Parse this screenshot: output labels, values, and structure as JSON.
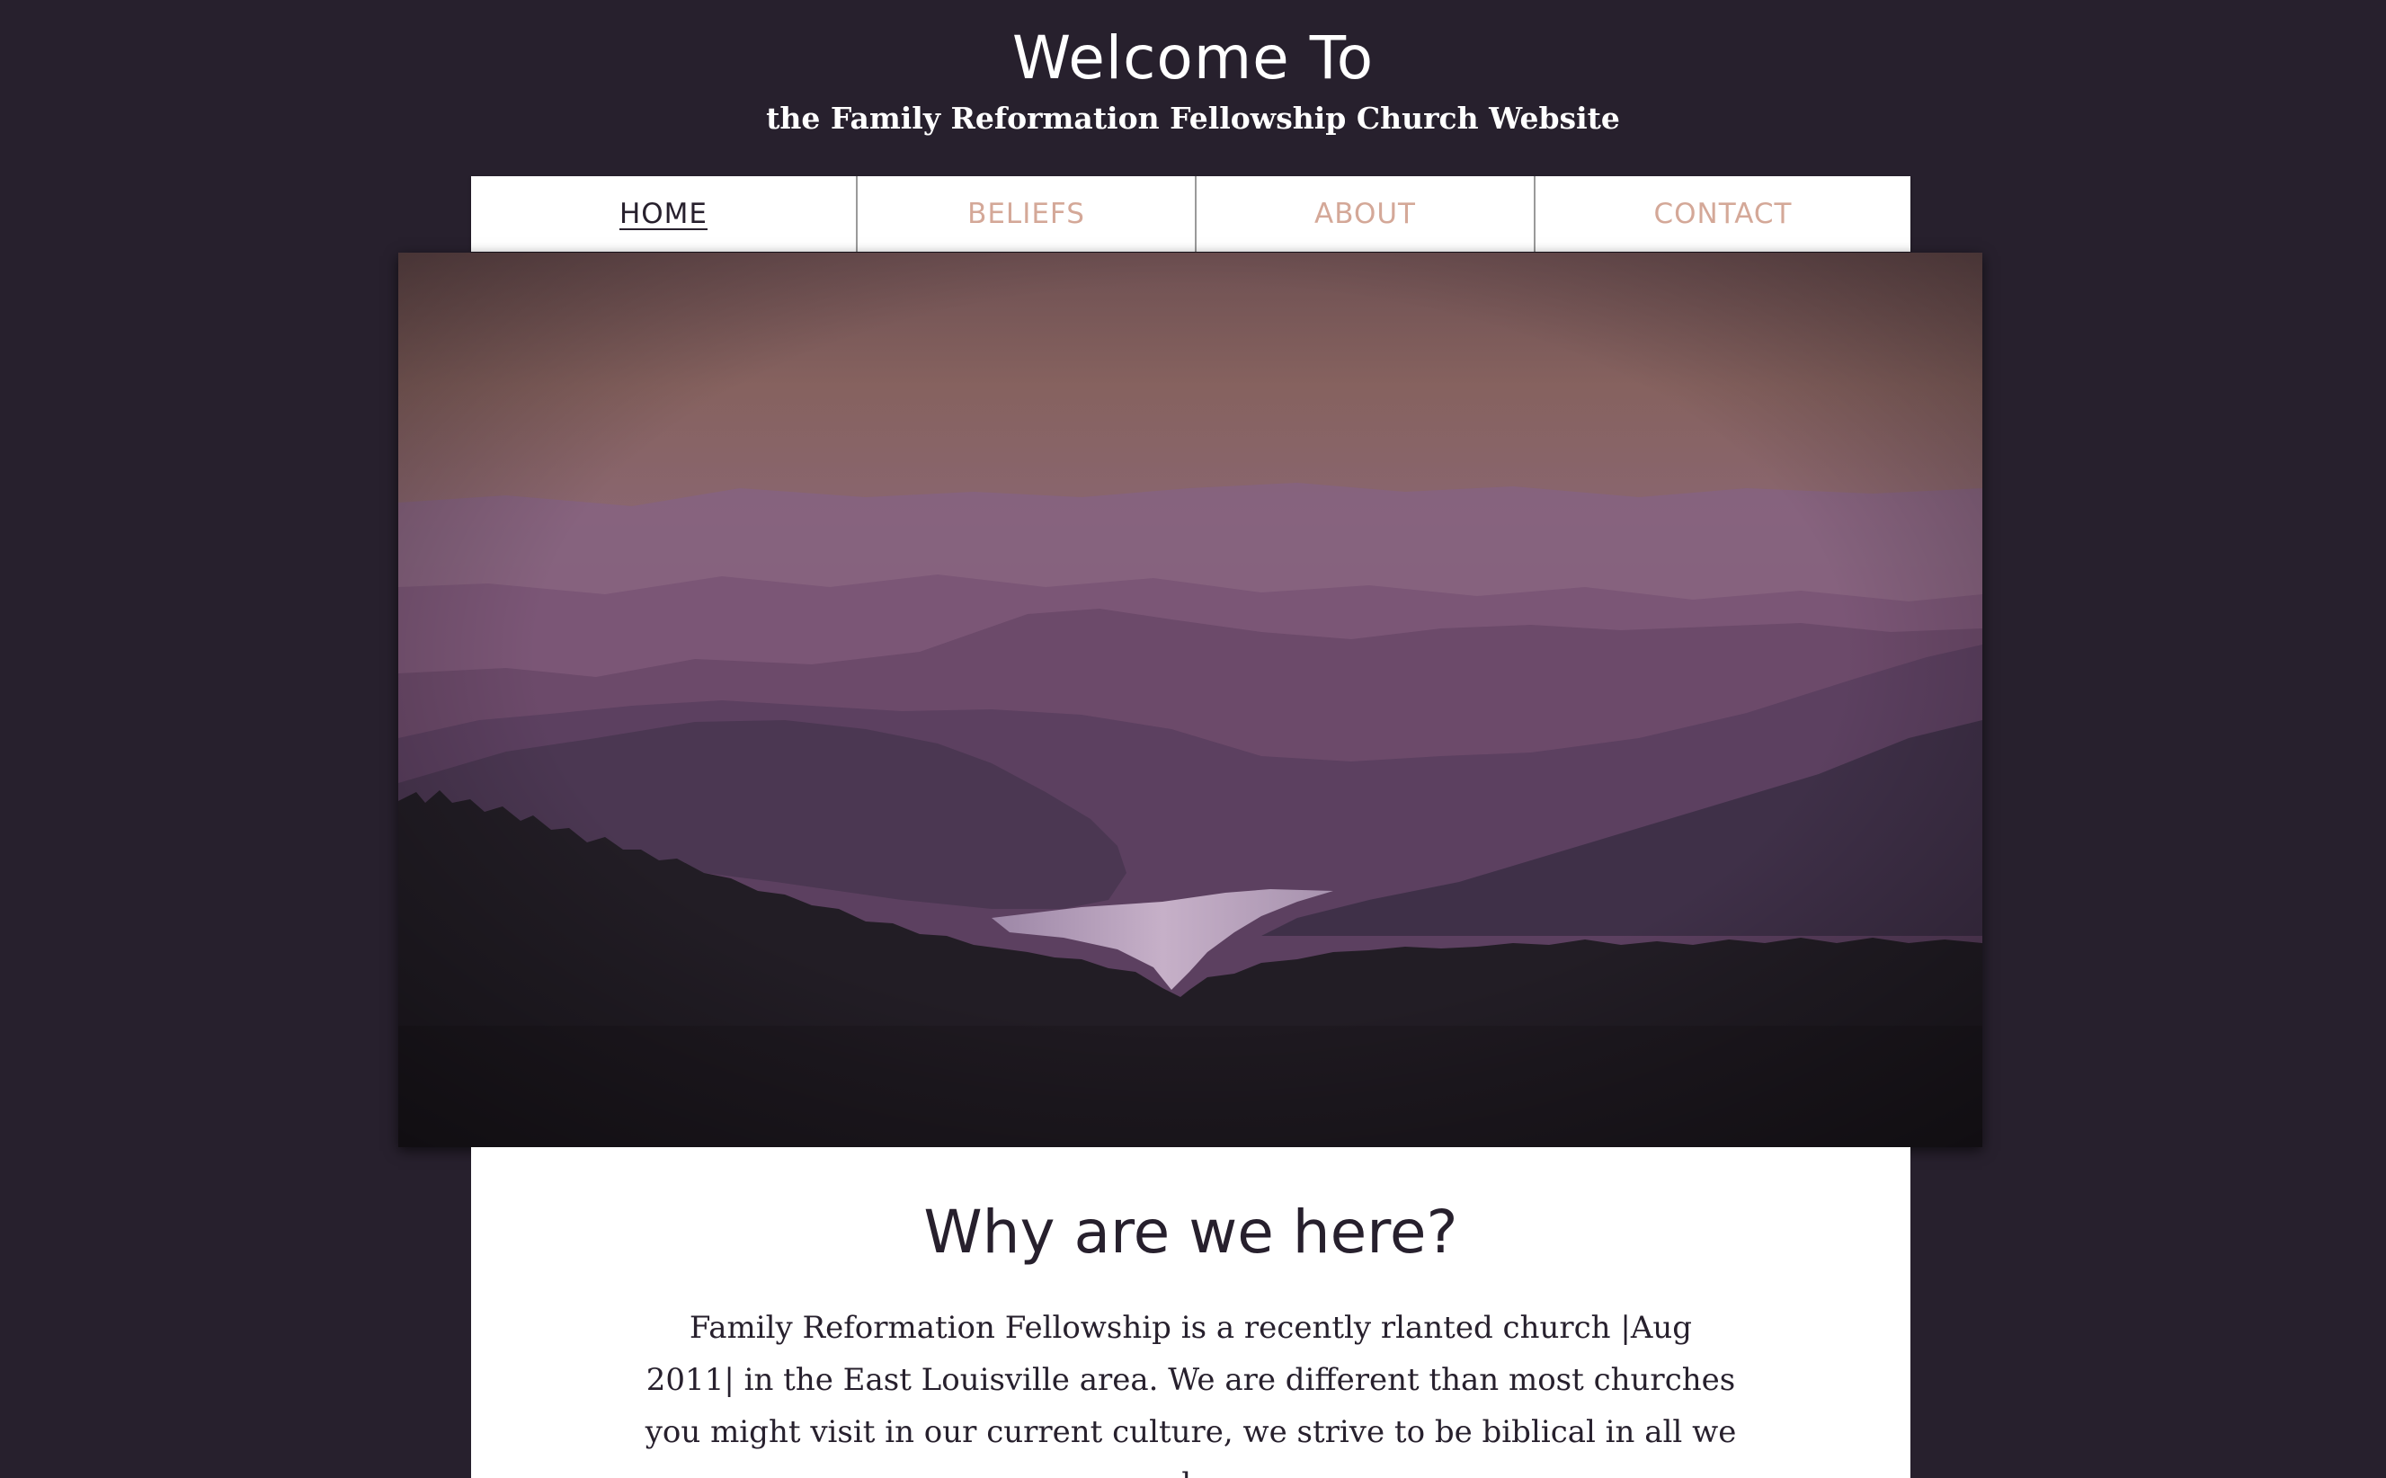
{
  "header": {
    "title": "Welcome To",
    "subtitle": "the Family Reformation Fellowship Church Website"
  },
  "nav": {
    "items": [
      {
        "label": "HOME",
        "active": true
      },
      {
        "label": "BELIEFS",
        "active": false
      },
      {
        "label": "ABOUT",
        "active": false
      },
      {
        "label": "CONTACT",
        "active": false
      }
    ]
  },
  "main": {
    "heading": "Why are we here?",
    "body": "Family Reformation Fellowship is a recently rlanted church |Aug 2011| in the East Louisville area. We are different than most churches you might visit in our current culture, we strive to be biblical in all we do"
  },
  "colors": {
    "page_background": "#27202d",
    "nav_link": "#d4a898",
    "nav_active": "#27202d",
    "text_dark": "#27202d"
  }
}
